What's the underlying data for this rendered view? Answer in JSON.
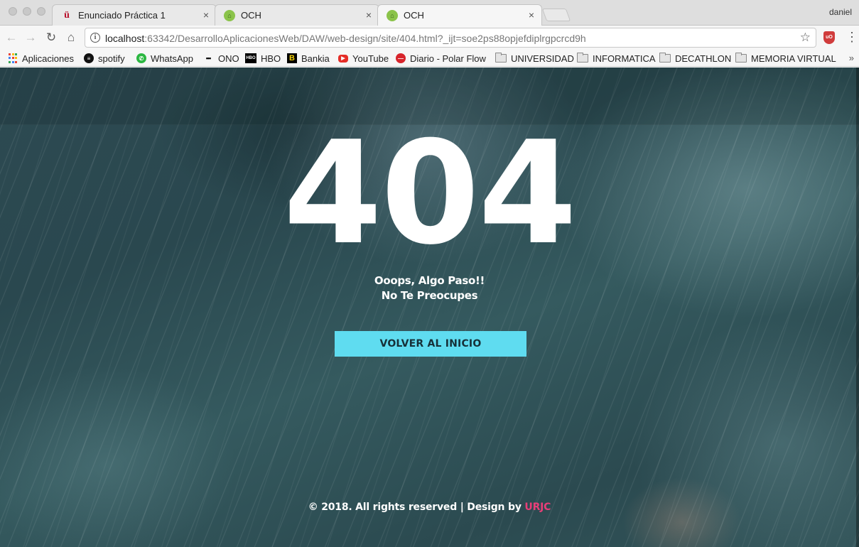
{
  "browser": {
    "profile_name": "daniel",
    "tabs": [
      {
        "title": "Enunciado Práctica 1",
        "favicon": "urjc-icon",
        "active": false
      },
      {
        "title": "OCH",
        "favicon": "house-icon",
        "active": false
      },
      {
        "title": "OCH",
        "favicon": "house-icon",
        "active": true
      }
    ],
    "url": {
      "host": "localhost",
      "rest": ":63342/DesarrolloAplicacionesWeb/DAW/web-design/site/404.html?_ijt=soe2ps88opjefdiplrgpcrcd9h"
    },
    "bookmarks": [
      {
        "label": "Aplicaciones",
        "icon": "apps-grid-icon"
      },
      {
        "label": "spotify",
        "icon": "spotify-icon"
      },
      {
        "label": "WhatsApp",
        "icon": "whatsapp-icon"
      },
      {
        "label": "ONO",
        "icon": "ono-icon"
      },
      {
        "label": "HBO",
        "icon": "hbo-icon"
      },
      {
        "label": "Bankia",
        "icon": "bankia-icon"
      },
      {
        "label": "YouTube",
        "icon": "youtube-icon"
      },
      {
        "label": "Diario - Polar Flow",
        "icon": "polar-icon"
      },
      {
        "label": "UNIVERSIDAD",
        "icon": "folder-icon"
      },
      {
        "label": "INFORMATICA",
        "icon": "folder-icon"
      },
      {
        "label": "DECATHLON",
        "icon": "folder-icon"
      },
      {
        "label": "MEMORIA VIRTUAL",
        "icon": "folder-icon"
      }
    ],
    "icon_glyphs": {
      "close": "×",
      "back": "←",
      "forward": "→",
      "reload": "↻",
      "home": "⌂",
      "info": "i",
      "star": "☆",
      "menu": "⋮",
      "more": "»"
    }
  },
  "page": {
    "error_code": "404",
    "message_line1": "Ooops, Algo Paso!!",
    "message_line2": "No Te Preocupes",
    "button_label": "VOLVER AL INICIO",
    "footer_text": "© 2018. All rights reserved | Design by ",
    "footer_brand": "URJC",
    "colors": {
      "button_bg": "#5fdcf0",
      "brand": "#e83e78",
      "background": "#2d4a52"
    }
  }
}
